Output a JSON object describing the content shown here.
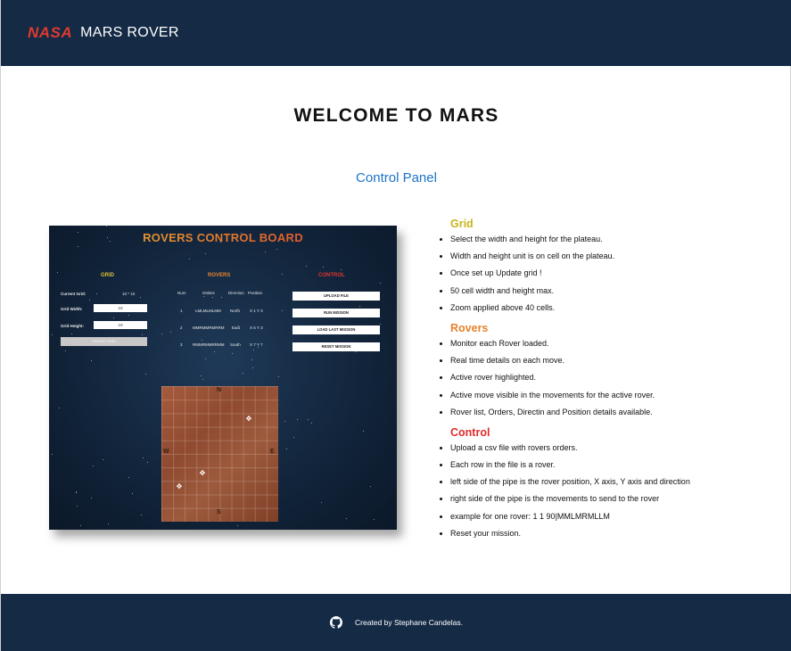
{
  "header": {
    "logo_text": "NASA",
    "app_title": "MARS ROVER"
  },
  "main": {
    "welcome": "WELCOME TO MARS",
    "control_panel_link": "Control Panel"
  },
  "board_image": {
    "title": "ROVERS CONTROL BOARD",
    "grid": {
      "title": "GRID",
      "current_grid_label": "Current Grid:",
      "current_grid_value": "10 * 10",
      "width_label": "Grid Width:",
      "width_value": "10",
      "height_label": "Grid Height:",
      "height_value": "10",
      "update_button": "UPDATE GRID"
    },
    "rovers": {
      "title": "ROVERS",
      "headers": [
        "Num",
        "Orders",
        "Direction",
        "Position"
      ],
      "rows": [
        [
          "1",
          "LMLMLMLMM",
          "North",
          "X 1 Y 3"
        ],
        [
          "2",
          "MMRMMRMRRM",
          "East",
          "X 5 Y 3"
        ],
        [
          "3",
          "RMMRMMRRMM",
          "South",
          "X 7 Y 7"
        ]
      ]
    },
    "control": {
      "title": "CONTROL",
      "buttons": [
        "UPLOAD FILE",
        "RUN MISSION",
        "LOAD LAST MISSION",
        "RESET MISSION"
      ]
    },
    "compass": {
      "n": "N",
      "s": "S",
      "w": "W",
      "e": "E"
    }
  },
  "info": {
    "grid": {
      "title": "Grid",
      "items": [
        "Select the width and height for the plateau.",
        "Width and height unit is on cell on the plateau.",
        "Once set up Update grid !",
        "50 cell width and height max.",
        "Zoom applied above 40 cells."
      ]
    },
    "rovers": {
      "title": "Rovers",
      "items": [
        "Monitor each Rover loaded.",
        "Real time details on each move.",
        "Active rover highlighted.",
        "Active move visible in the movements for the active rover.",
        "Rover list, Orders, Directin and Position details available."
      ]
    },
    "control": {
      "title": "Control",
      "items": [
        "Upload a csv file with rovers orders.",
        "Each row in the file is a rover.",
        "left side of the pipe is the rover position, X axis, Y axis and direction",
        "right side of the pipe is the movements to send to the rover",
        "example for one rover: 1 1 90|MMLMRMLLM",
        "Reset your mission."
      ]
    }
  },
  "footer": {
    "icon": "github-icon",
    "credit": "Created by Stephane Candelas."
  },
  "colors": {
    "navbar": "#142a45",
    "nasa_red": "#e03a2e",
    "link_blue": "#1a73c9",
    "grid_yellow": "#c9b51c",
    "rovers_orange": "#e6842f",
    "control_red": "#e02b2b"
  }
}
